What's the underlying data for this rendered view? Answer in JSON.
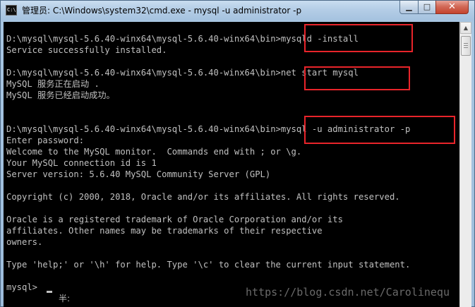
{
  "window": {
    "title": "管理员: C:\\Windows\\system32\\cmd.exe - mysql  -u administrator -p",
    "icon": "cmd-prompt-icon",
    "controls": {
      "minimize_glyph": "▁",
      "maximize_glyph": "□",
      "close_glyph": "✕"
    }
  },
  "console": {
    "text_color": "#c0c0c0",
    "background": "#000000",
    "lines": [
      "D:\\mysql\\mysql-5.6.40-winx64\\mysql-5.6.40-winx64\\bin>mysqld -install",
      "Service successfully installed.",
      "D:\\mysql\\mysql-5.6.40-winx64\\mysql-5.6.40-winx64\\bin>net start mysql",
      "MySQL 服务正在启动 .",
      "MySQL 服务已经启动成功。",
      "D:\\mysql\\mysql-5.6.40-winx64\\mysql-5.6.40-winx64\\bin>mysql -u administrator -p",
      "Enter password:",
      "Welcome to the MySQL monitor.  Commands end with ; or \\g.",
      "Your MySQL connection id is 1",
      "Server version: 5.6.40 MySQL Community Server (GPL)",
      "Copyright (c) 2000, 2018, Oracle and/or its affiliates. All rights reserved.",
      "Oracle is a registered trademark of Oracle Corporation and/or its",
      "affiliates. Other names may be trademarks of their respective",
      "owners.",
      "Type 'help;' or '\\h' for help. Type '\\c' to clear the current input statement.",
      "mysql> "
    ],
    "ime_status": "半:",
    "highlight_color": "#e8242a",
    "watermark": "https://blog.csdn.net/Carolinequ"
  }
}
